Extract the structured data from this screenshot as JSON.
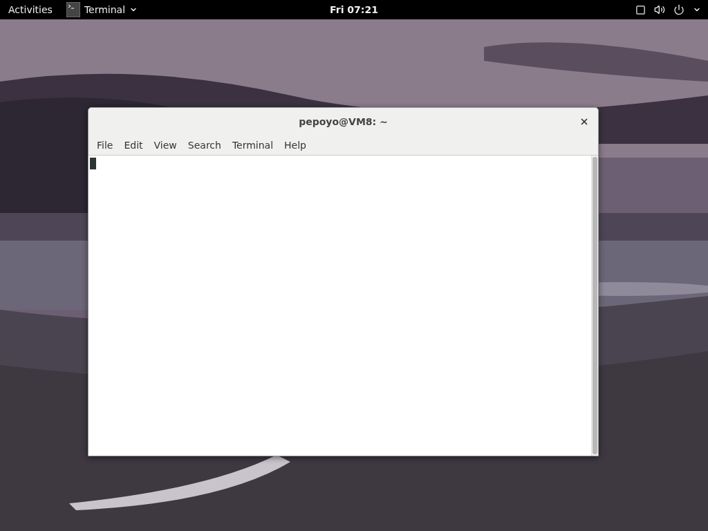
{
  "top_bar": {
    "activities": "Activities",
    "app_menu": "Terminal",
    "clock": "Fri 07:21"
  },
  "window": {
    "title": "pepoyo@VM8: ~",
    "menu": [
      "File",
      "Edit",
      "View",
      "Search",
      "Terminal",
      "Help"
    ]
  }
}
